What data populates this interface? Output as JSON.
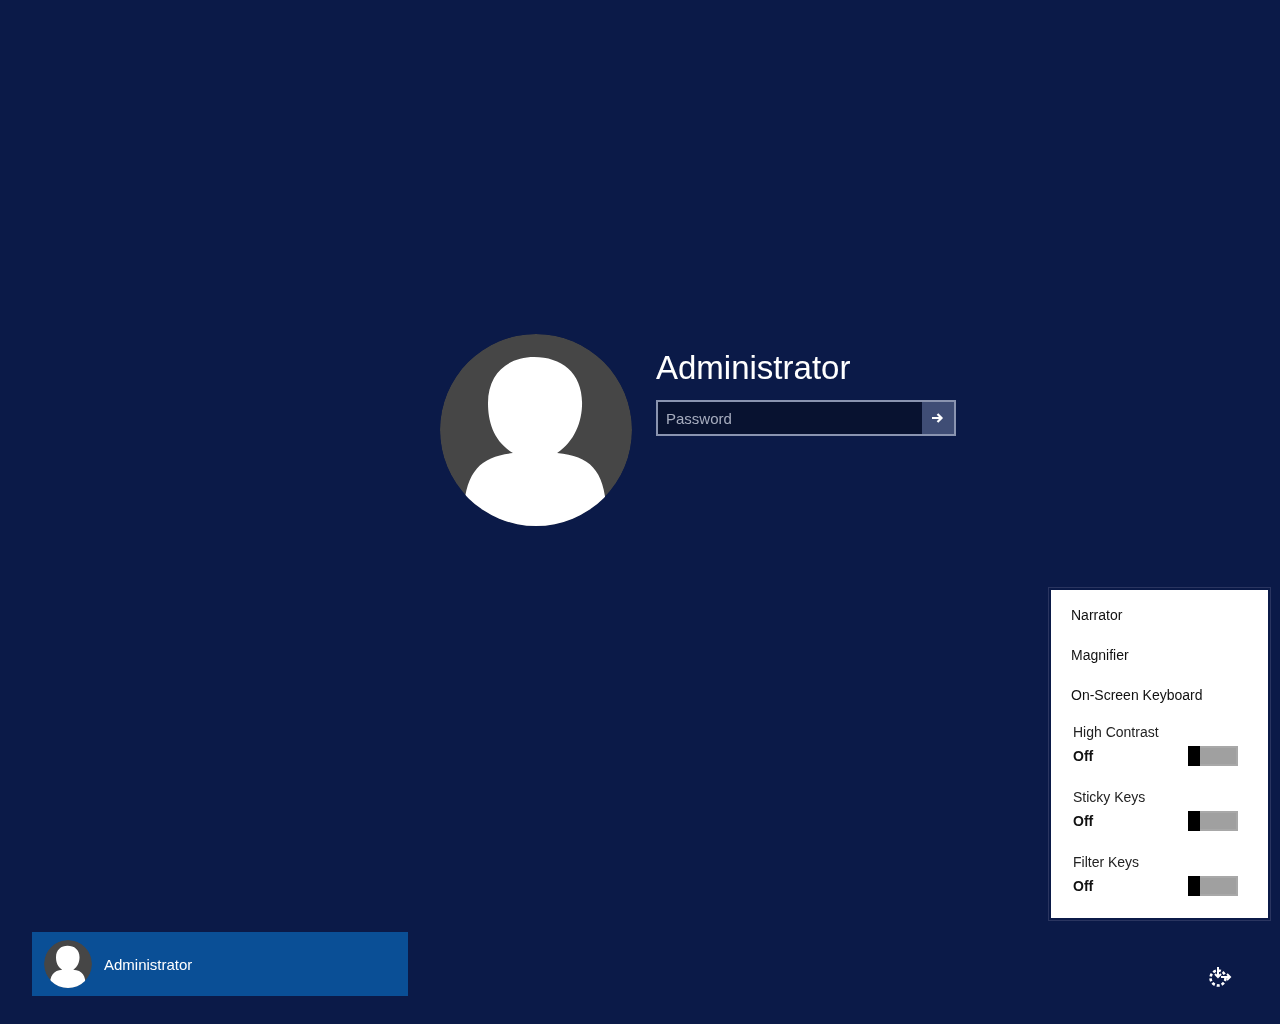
{
  "login": {
    "user_name": "Administrator",
    "password": {
      "placeholder": "Password"
    }
  },
  "ease_of_access_menu": {
    "items": [
      {
        "kind": "link",
        "label": "Narrator"
      },
      {
        "kind": "link",
        "label": "Magnifier"
      },
      {
        "kind": "link",
        "label": "On-Screen Keyboard"
      },
      {
        "kind": "toggle",
        "label": "High Contrast",
        "state": "Off",
        "on": false
      },
      {
        "kind": "toggle",
        "label": "Sticky Keys",
        "state": "Off",
        "on": false
      },
      {
        "kind": "toggle",
        "label": "Filter Keys",
        "state": "Off",
        "on": false
      }
    ]
  },
  "user_tiles": [
    {
      "name": "Administrator",
      "selected": true
    }
  ]
}
